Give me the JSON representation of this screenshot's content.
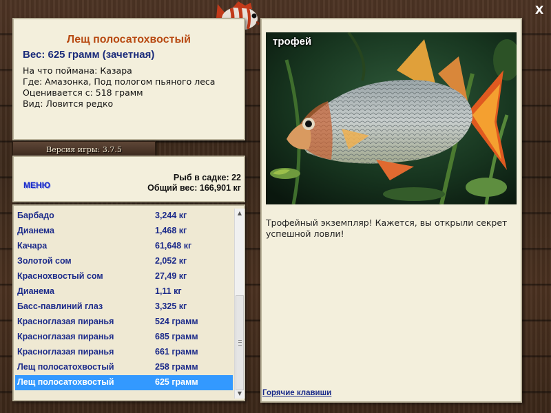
{
  "fish_info": {
    "title": "Лещ полосатохвостый",
    "weight": "Вес: 625 грамм (зачетная)",
    "bait": "На что поймана: Казара",
    "location": "Где: Амазонка, Под пологом пьяного леса",
    "valued_from": "Оценивается с: 518 грамм",
    "species": "Вид: Ловится редко"
  },
  "version": "Версия игры: 3.7.5",
  "menu_label": "МЕНЮ",
  "stats": {
    "fish_count": "Рыб в садке: 22",
    "total_weight": "Общий вес: 166,901 кг"
  },
  "catch_list": [
    {
      "name": "Барбадо",
      "weight": "3,244 кг"
    },
    {
      "name": "Дианема",
      "weight": "1,468 кг"
    },
    {
      "name": "Качара",
      "weight": "61,648 кг"
    },
    {
      "name": "Золотой сом",
      "weight": "2,052 кг"
    },
    {
      "name": "Краснохвостый сом",
      "weight": "27,49 кг"
    },
    {
      "name": "Дианема",
      "weight": "1,11 кг"
    },
    {
      "name": "Басс-павлиний глаз",
      "weight": "3,325 кг"
    },
    {
      "name": "Красноглазая пиранья",
      "weight": "524 грамм"
    },
    {
      "name": "Красноглазая пиранья",
      "weight": "685 грамм"
    },
    {
      "name": "Красноглазая пиранья",
      "weight": "661 грамм"
    },
    {
      "name": "Лещ полосатохвостый",
      "weight": "258 грамм"
    },
    {
      "name": "Лещ полосатохвостый",
      "weight": "625 грамм",
      "selected": true
    }
  ],
  "trophy": {
    "label": "трофей",
    "description": "Трофейный экземпляр! Кажется, вы открыли секрет успешной ловли!"
  },
  "hotkeys_link": "Горячие клавиши",
  "close_label": "X",
  "colors": {
    "title": "#b84a12",
    "accent_text": "#1a2b7a",
    "selection": "#3399ff",
    "panel": "#f3efdc"
  },
  "icons": [
    "logo-fish-icon",
    "close-icon",
    "scroll-up-arrow-icon",
    "scroll-down-arrow-icon"
  ]
}
